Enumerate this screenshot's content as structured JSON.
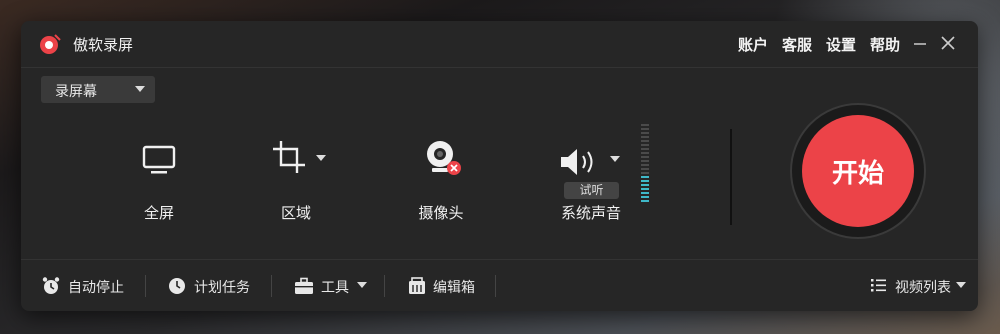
{
  "app": {
    "title": "傲软录屏"
  },
  "top_menu": {
    "account": "账户",
    "service": "客服",
    "settings": "设置",
    "help": "帮助"
  },
  "mode": {
    "selected": "录屏幕"
  },
  "tools": {
    "fullscreen": "全屏",
    "region": "区域",
    "webcam": "摄像头",
    "system_audio": "系统声音",
    "listen": "试听"
  },
  "start": {
    "label": "开始"
  },
  "bottom": {
    "auto_stop": "自动停止",
    "scheduled_task": "计划任务",
    "tools": "工具",
    "editor": "编辑箱",
    "video_list": "视频列表"
  },
  "colors": {
    "accent": "#ec4348",
    "window_bg": "#262626",
    "meter": "#3fb8c8"
  }
}
